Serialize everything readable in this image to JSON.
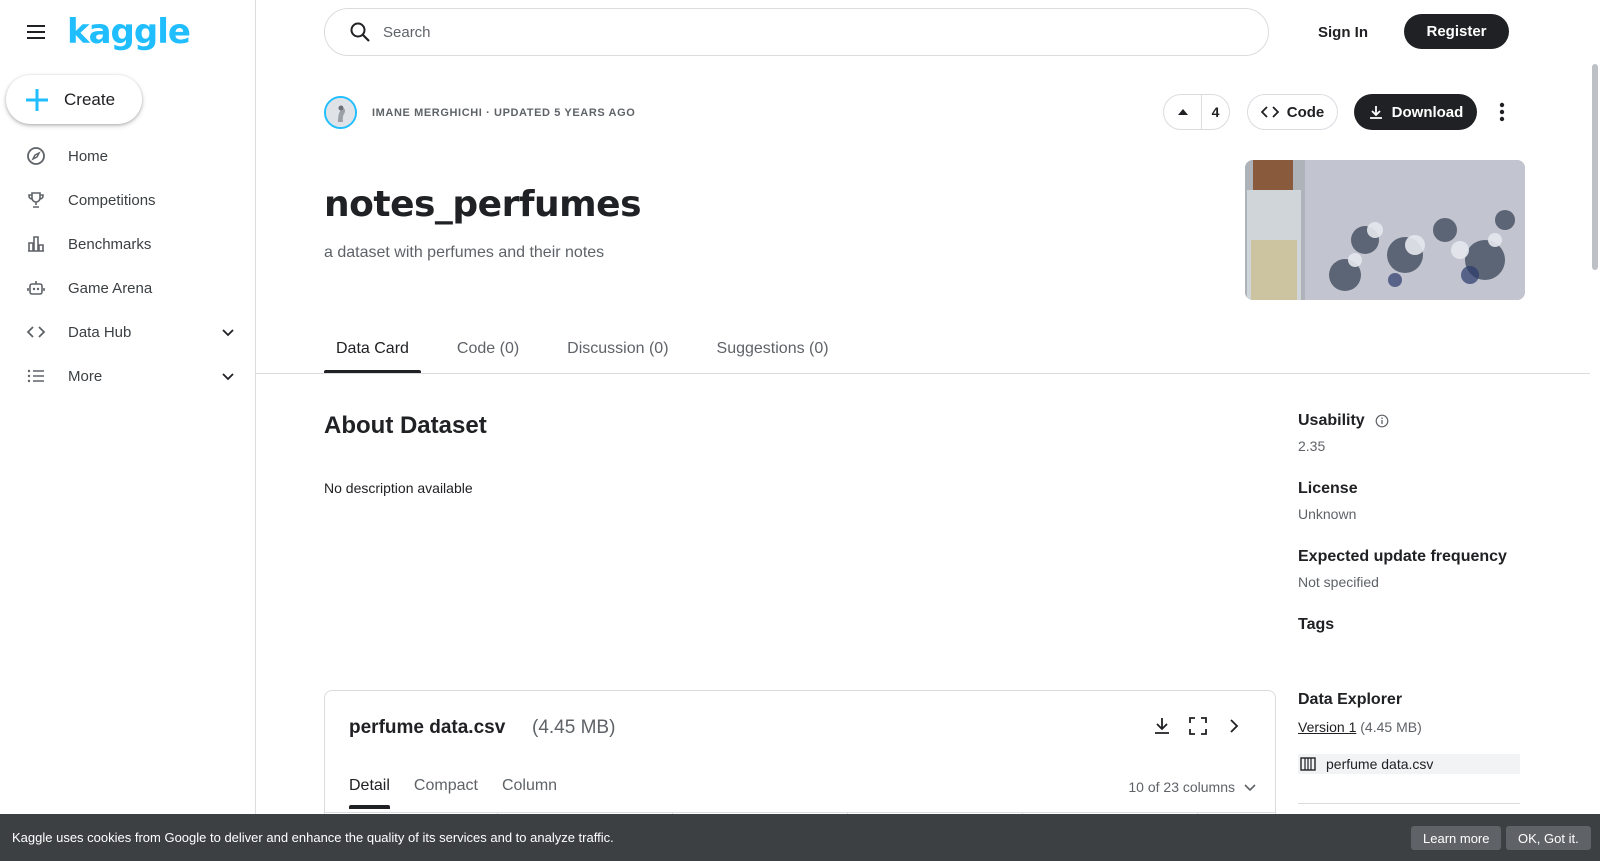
{
  "app": {
    "logo_text": "kaggle",
    "accent": "#20beff",
    "dark": "#202124"
  },
  "sidebar": {
    "create_label": "Create",
    "items": [
      {
        "label": "Home",
        "icon": "compass-icon"
      },
      {
        "label": "Competitions",
        "icon": "trophy-icon"
      },
      {
        "label": "Benchmarks",
        "icon": "bar-chart-icon"
      },
      {
        "label": "Game Arena",
        "icon": "robot-icon"
      },
      {
        "label": "Data Hub",
        "icon": "code-brackets-icon"
      },
      {
        "label": "More",
        "icon": "list-icon"
      }
    ]
  },
  "topbar": {
    "search_placeholder": "Search",
    "signin_label": "Sign In",
    "register_label": "Register"
  },
  "dataset": {
    "author_line": "IMANE MERGHICHI · UPDATED 5 YEARS AGO",
    "upvotes": "4",
    "code_label": "Code",
    "download_label": "Download",
    "title": "notes_perfumes",
    "subtitle": "a dataset with perfumes and their notes"
  },
  "tabs": [
    {
      "label": "Data Card"
    },
    {
      "label": "Code (0)"
    },
    {
      "label": "Discussion (0)"
    },
    {
      "label": "Suggestions (0)"
    }
  ],
  "about": {
    "heading": "About Dataset",
    "description": "No description available"
  },
  "meta": {
    "usability_label": "Usability",
    "usability_value": "2.35",
    "license_label": "License",
    "license_value": "Unknown",
    "frequency_label": "Expected update frequency",
    "frequency_value": "Not specified",
    "tags_label": "Tags"
  },
  "explorer": {
    "heading": "Data Explorer",
    "version_link": "Version 1",
    "version_size": "(4.45 MB)",
    "file_name": "perfume data.csv"
  },
  "file_card": {
    "name": "perfume data.csv",
    "size": "(4.45 MB)",
    "tabs": [
      {
        "label": "Detail"
      },
      {
        "label": "Compact"
      },
      {
        "label": "Column"
      }
    ],
    "columns_selector": "10 of 23 columns"
  },
  "cookie": {
    "message": "Kaggle uses cookies from Google to deliver and enhance the quality of its services and to analyze traffic.",
    "learn_more": "Learn more",
    "ok": "OK, Got it."
  }
}
